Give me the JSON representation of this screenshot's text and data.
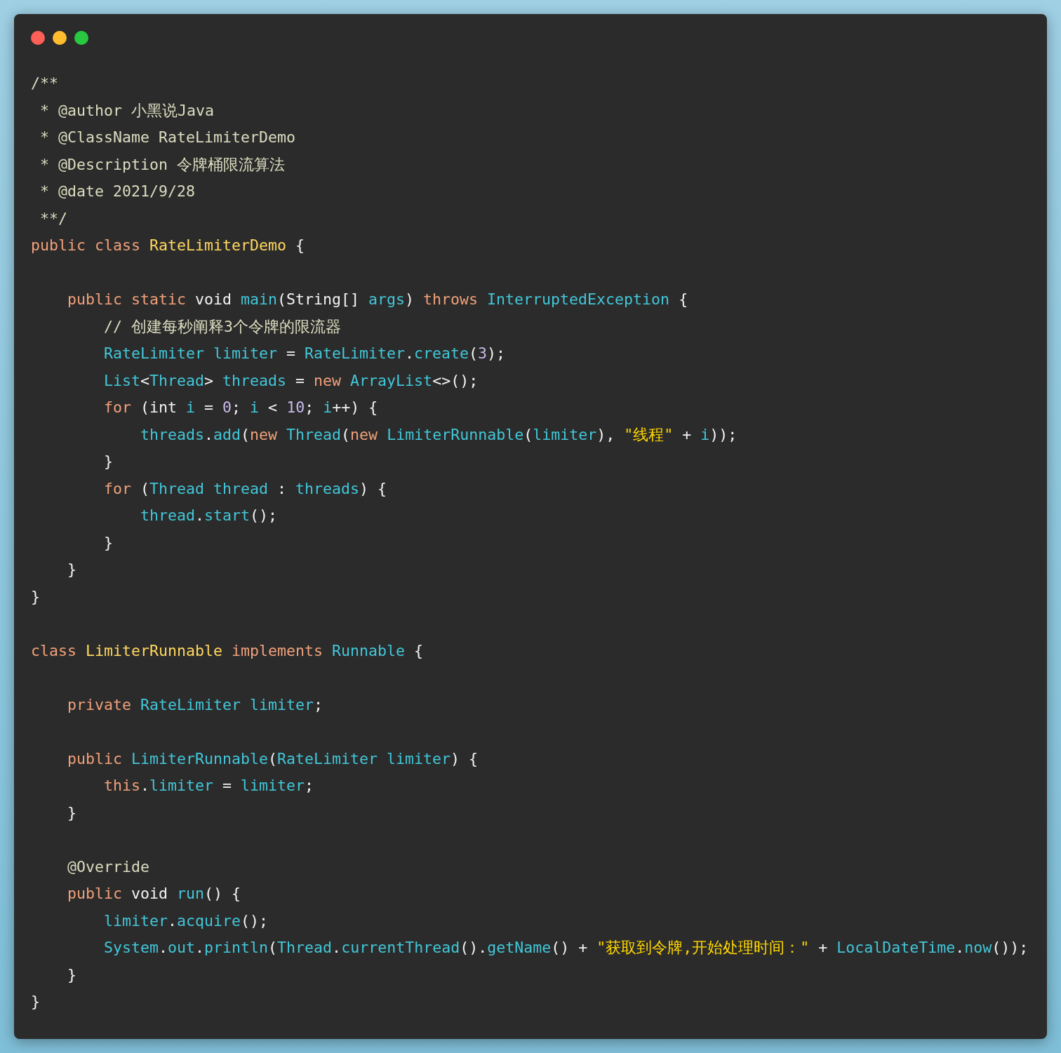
{
  "code": {
    "lines": [
      {
        "tokens": [
          {
            "kind": "comment",
            "text": "/**"
          }
        ]
      },
      {
        "tokens": [
          {
            "kind": "comment",
            "text": " * @author 小黑说Java"
          }
        ]
      },
      {
        "tokens": [
          {
            "kind": "comment",
            "text": " * @ClassName RateLimiterDemo"
          }
        ]
      },
      {
        "tokens": [
          {
            "kind": "comment",
            "text": " * @Description 令牌桶限流算法"
          }
        ]
      },
      {
        "tokens": [
          {
            "kind": "comment",
            "text": " * @date 2021/9/28"
          }
        ]
      },
      {
        "tokens": [
          {
            "kind": "comment",
            "text": " **/"
          }
        ]
      },
      {
        "tokens": [
          {
            "kind": "keyword",
            "text": "public class "
          },
          {
            "kind": "classname",
            "text": "RateLimiterDemo"
          },
          {
            "kind": "plain",
            "text": " {"
          }
        ]
      },
      {
        "kind": "blank"
      },
      {
        "tokens": [
          {
            "kind": "keyword",
            "text": "    public static "
          },
          {
            "kind": "plain",
            "text": "void "
          },
          {
            "kind": "ident",
            "text": "main"
          },
          {
            "kind": "plain",
            "text": "(String[] "
          },
          {
            "kind": "ident",
            "text": "args"
          },
          {
            "kind": "plain",
            "text": ") "
          },
          {
            "kind": "keyword",
            "text": "throws "
          },
          {
            "kind": "ident",
            "text": "InterruptedException"
          },
          {
            "kind": "plain",
            "text": " {"
          }
        ]
      },
      {
        "tokens": [
          {
            "kind": "comment",
            "text": "        // 创建每秒阐释3个令牌的限流器"
          }
        ]
      },
      {
        "tokens": [
          {
            "kind": "ident",
            "text": "        RateLimiter limiter"
          },
          {
            "kind": "plain",
            "text": " = "
          },
          {
            "kind": "ident",
            "text": "RateLimiter"
          },
          {
            "kind": "plain",
            "text": "."
          },
          {
            "kind": "ident",
            "text": "create"
          },
          {
            "kind": "plain",
            "text": "("
          },
          {
            "kind": "number",
            "text": "3"
          },
          {
            "kind": "plain",
            "text": ");"
          }
        ]
      },
      {
        "tokens": [
          {
            "kind": "ident",
            "text": "        List"
          },
          {
            "kind": "plain",
            "text": "<"
          },
          {
            "kind": "ident",
            "text": "Thread"
          },
          {
            "kind": "plain",
            "text": "> "
          },
          {
            "kind": "ident",
            "text": "threads"
          },
          {
            "kind": "plain",
            "text": " = "
          },
          {
            "kind": "keyword",
            "text": "new "
          },
          {
            "kind": "ident",
            "text": "ArrayList"
          },
          {
            "kind": "plain",
            "text": "<>();"
          }
        ]
      },
      {
        "tokens": [
          {
            "kind": "keyword",
            "text": "        for "
          },
          {
            "kind": "plain",
            "text": "(int "
          },
          {
            "kind": "ident",
            "text": "i"
          },
          {
            "kind": "plain",
            "text": " = "
          },
          {
            "kind": "number",
            "text": "0"
          },
          {
            "kind": "plain",
            "text": "; "
          },
          {
            "kind": "ident",
            "text": "i"
          },
          {
            "kind": "plain",
            "text": " < "
          },
          {
            "kind": "number",
            "text": "10"
          },
          {
            "kind": "plain",
            "text": "; "
          },
          {
            "kind": "ident",
            "text": "i"
          },
          {
            "kind": "plain",
            "text": "++) {"
          }
        ]
      },
      {
        "tokens": [
          {
            "kind": "ident",
            "text": "            threads"
          },
          {
            "kind": "plain",
            "text": "."
          },
          {
            "kind": "ident",
            "text": "add"
          },
          {
            "kind": "plain",
            "text": "("
          },
          {
            "kind": "keyword",
            "text": "new "
          },
          {
            "kind": "ident",
            "text": "Thread"
          },
          {
            "kind": "plain",
            "text": "("
          },
          {
            "kind": "keyword",
            "text": "new "
          },
          {
            "kind": "ident",
            "text": "LimiterRunnable"
          },
          {
            "kind": "plain",
            "text": "("
          },
          {
            "kind": "ident",
            "text": "limiter"
          },
          {
            "kind": "plain",
            "text": "), "
          },
          {
            "kind": "string",
            "text": "\"线程\""
          },
          {
            "kind": "plain",
            "text": " + "
          },
          {
            "kind": "ident",
            "text": "i"
          },
          {
            "kind": "plain",
            "text": "));"
          }
        ]
      },
      {
        "tokens": [
          {
            "kind": "plain",
            "text": "        }"
          }
        ]
      },
      {
        "tokens": [
          {
            "kind": "keyword",
            "text": "        for "
          },
          {
            "kind": "plain",
            "text": "("
          },
          {
            "kind": "ident",
            "text": "Thread thread"
          },
          {
            "kind": "plain",
            "text": " : "
          },
          {
            "kind": "ident",
            "text": "threads"
          },
          {
            "kind": "plain",
            "text": ") {"
          }
        ]
      },
      {
        "tokens": [
          {
            "kind": "ident",
            "text": "            thread"
          },
          {
            "kind": "plain",
            "text": "."
          },
          {
            "kind": "ident",
            "text": "start"
          },
          {
            "kind": "plain",
            "text": "();"
          }
        ]
      },
      {
        "tokens": [
          {
            "kind": "plain",
            "text": "        }"
          }
        ]
      },
      {
        "tokens": [
          {
            "kind": "plain",
            "text": "    }"
          }
        ]
      },
      {
        "tokens": [
          {
            "kind": "plain",
            "text": "}"
          }
        ]
      },
      {
        "kind": "blank"
      },
      {
        "tokens": [
          {
            "kind": "keyword",
            "text": "class "
          },
          {
            "kind": "classname",
            "text": "LimiterRunnable "
          },
          {
            "kind": "keyword",
            "text": "implements "
          },
          {
            "kind": "ident",
            "text": "Runnable"
          },
          {
            "kind": "plain",
            "text": " {"
          }
        ]
      },
      {
        "kind": "blank"
      },
      {
        "tokens": [
          {
            "kind": "keyword",
            "text": "    private "
          },
          {
            "kind": "ident",
            "text": "RateLimiter limiter"
          },
          {
            "kind": "plain",
            "text": ";"
          }
        ]
      },
      {
        "kind": "blank"
      },
      {
        "tokens": [
          {
            "kind": "keyword",
            "text": "    public "
          },
          {
            "kind": "ident",
            "text": "LimiterRunnable"
          },
          {
            "kind": "plain",
            "text": "("
          },
          {
            "kind": "ident",
            "text": "RateLimiter limiter"
          },
          {
            "kind": "plain",
            "text": ") {"
          }
        ]
      },
      {
        "tokens": [
          {
            "kind": "keyword",
            "text": "        this"
          },
          {
            "kind": "plain",
            "text": "."
          },
          {
            "kind": "ident",
            "text": "limiter"
          },
          {
            "kind": "plain",
            "text": " = "
          },
          {
            "kind": "ident",
            "text": "limiter"
          },
          {
            "kind": "plain",
            "text": ";"
          }
        ]
      },
      {
        "tokens": [
          {
            "kind": "plain",
            "text": "    }"
          }
        ]
      },
      {
        "kind": "blank"
      },
      {
        "tokens": [
          {
            "kind": "comment",
            "text": "    @Override"
          }
        ]
      },
      {
        "tokens": [
          {
            "kind": "keyword",
            "text": "    public "
          },
          {
            "kind": "plain",
            "text": "void "
          },
          {
            "kind": "ident",
            "text": "run"
          },
          {
            "kind": "plain",
            "text": "() {"
          }
        ]
      },
      {
        "tokens": [
          {
            "kind": "ident",
            "text": "        limiter"
          },
          {
            "kind": "plain",
            "text": "."
          },
          {
            "kind": "ident",
            "text": "acquire"
          },
          {
            "kind": "plain",
            "text": "();"
          }
        ]
      },
      {
        "tokens": [
          {
            "kind": "ident",
            "text": "        System"
          },
          {
            "kind": "plain",
            "text": "."
          },
          {
            "kind": "ident",
            "text": "out"
          },
          {
            "kind": "plain",
            "text": "."
          },
          {
            "kind": "ident",
            "text": "println"
          },
          {
            "kind": "plain",
            "text": "("
          },
          {
            "kind": "ident",
            "text": "Thread"
          },
          {
            "kind": "plain",
            "text": "."
          },
          {
            "kind": "ident",
            "text": "currentThread"
          },
          {
            "kind": "plain",
            "text": "()."
          },
          {
            "kind": "ident",
            "text": "getName"
          },
          {
            "kind": "plain",
            "text": "() + "
          },
          {
            "kind": "string",
            "text": "\"获取到令牌,开始处理时间：\""
          },
          {
            "kind": "plain",
            "text": " + "
          },
          {
            "kind": "ident",
            "text": "LocalDateTime"
          },
          {
            "kind": "plain",
            "text": "."
          },
          {
            "kind": "ident",
            "text": "now"
          },
          {
            "kind": "plain",
            "text": "());"
          }
        ]
      },
      {
        "tokens": [
          {
            "kind": "plain",
            "text": "    }"
          }
        ]
      },
      {
        "tokens": [
          {
            "kind": "plain",
            "text": "}"
          }
        ]
      }
    ]
  }
}
